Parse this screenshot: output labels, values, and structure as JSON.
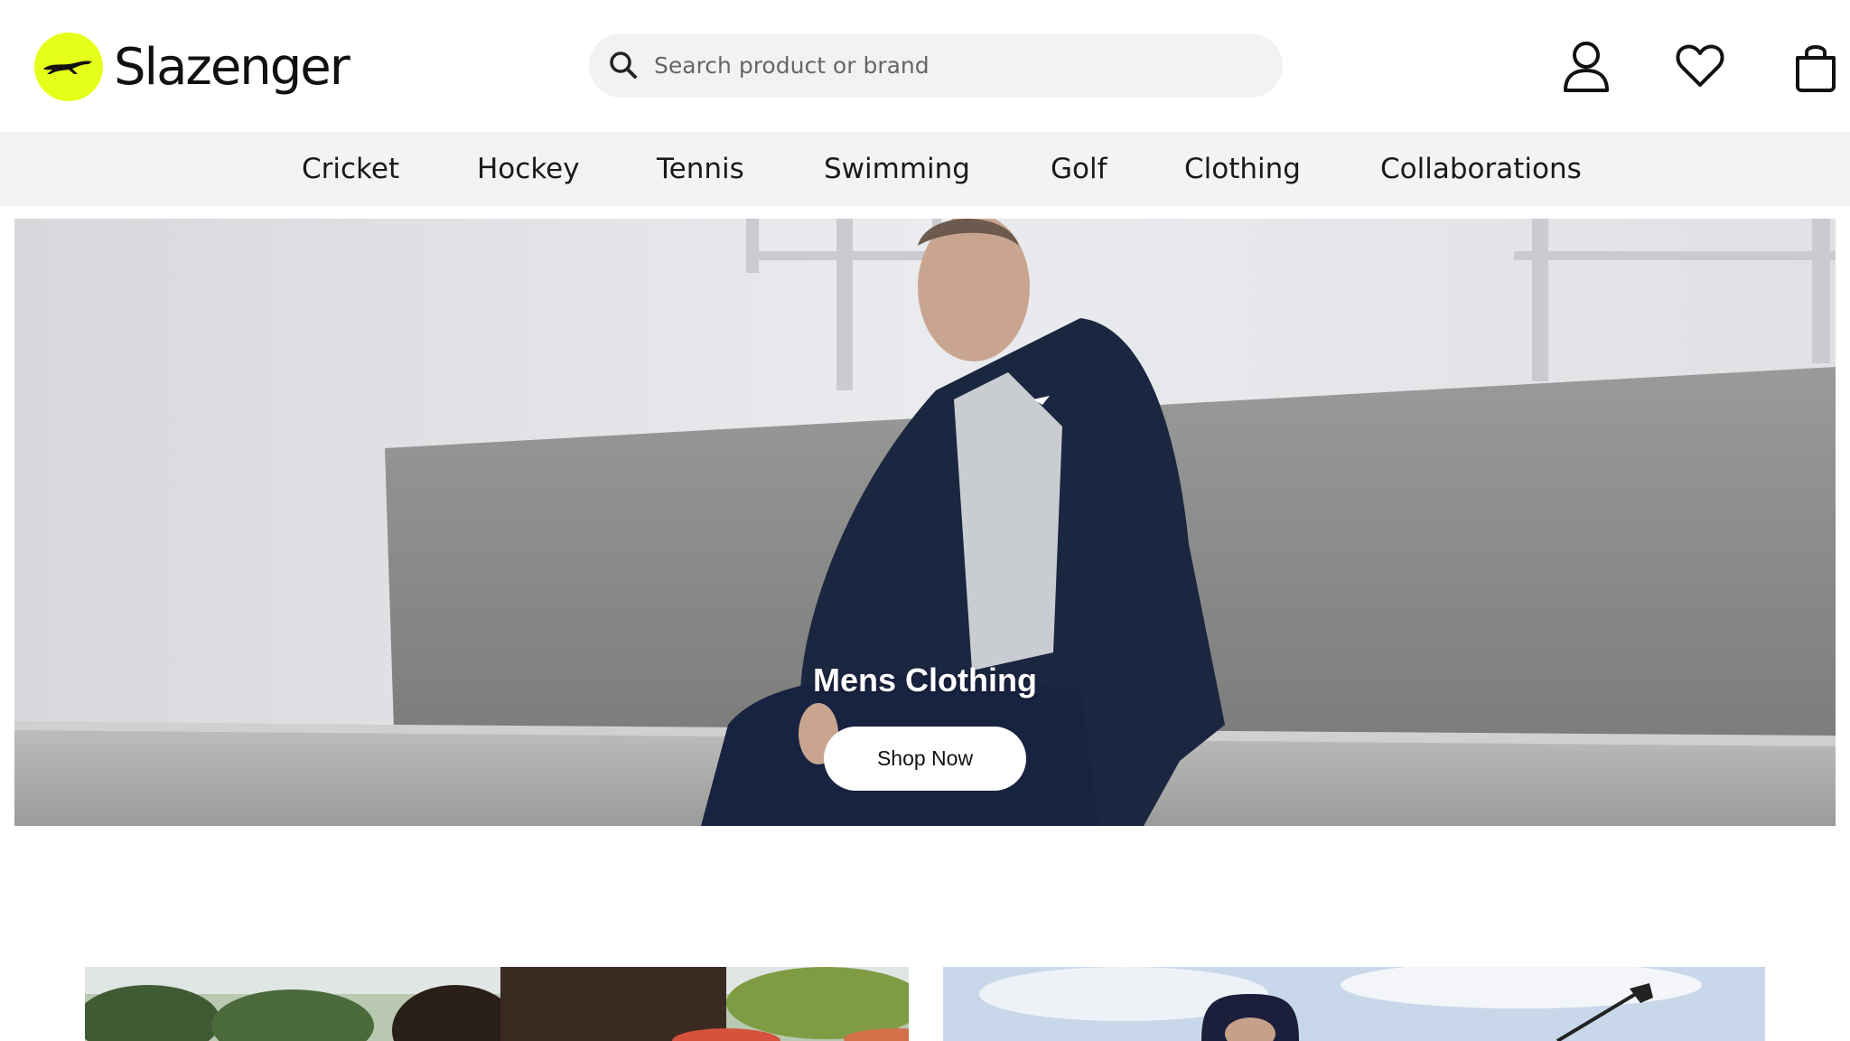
{
  "brand": {
    "name": "Slazenger",
    "logo_color": "#e6ff1a"
  },
  "search": {
    "placeholder": "Search product or brand",
    "icon": "search-icon"
  },
  "header_icons": [
    {
      "name": "account-icon"
    },
    {
      "name": "heart-icon"
    },
    {
      "name": "shopping-bag-icon"
    }
  ],
  "nav": {
    "items": [
      {
        "label": "Cricket"
      },
      {
        "label": "Hockey"
      },
      {
        "label": "Tennis"
      },
      {
        "label": "Swimming"
      },
      {
        "label": "Golf"
      },
      {
        "label": "Clothing"
      },
      {
        "label": "Collaborations"
      }
    ]
  },
  "hero": {
    "title": "Mens Clothing",
    "button_label": "Shop Now"
  },
  "colors": {
    "nav_bg": "#f3f3f3",
    "search_bg": "#f2f2f2",
    "accent": "#e6ff1a"
  }
}
